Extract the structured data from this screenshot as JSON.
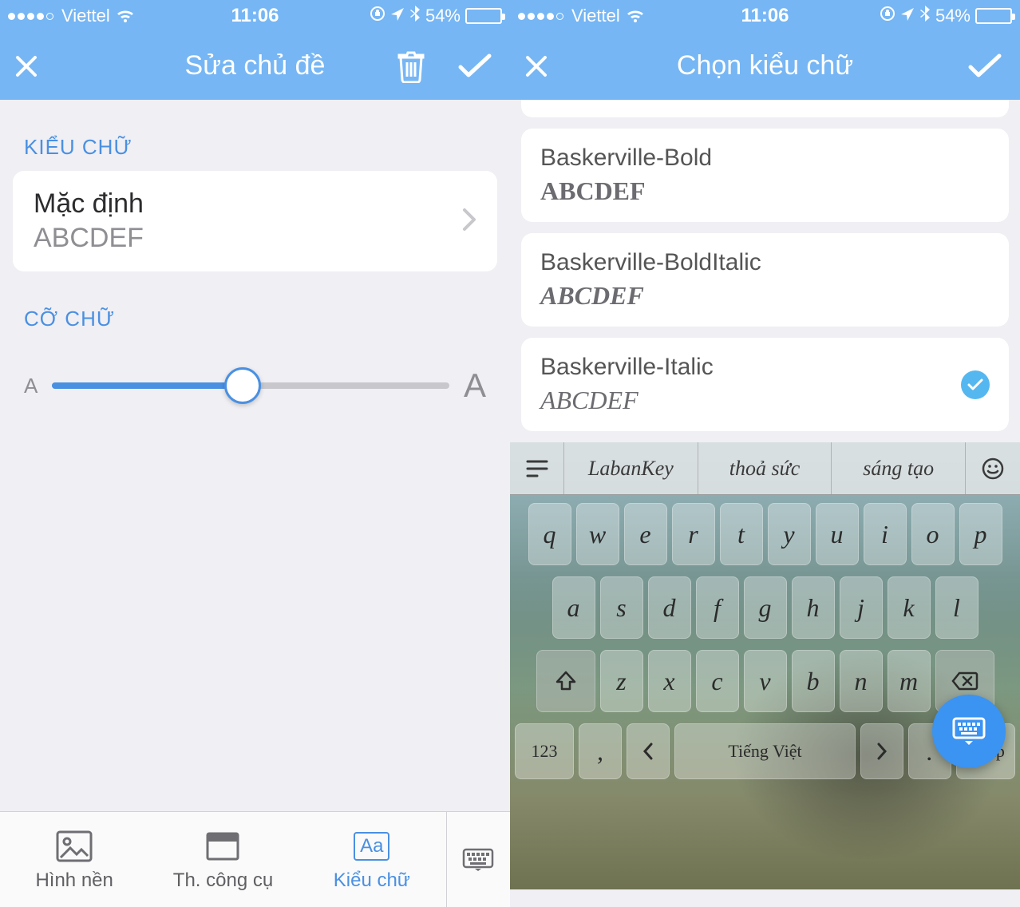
{
  "status": {
    "carrier": "Viettel",
    "time": "11:06",
    "battery_pct": "54%"
  },
  "left": {
    "nav_title": "Sửa chủ đề",
    "section_font": "KIỂU CHỮ",
    "font_row": {
      "title": "Mặc định",
      "sample": "ABCDEF"
    },
    "section_size": "CỠ CHỮ",
    "slider_min_label": "A",
    "slider_max_label": "A",
    "tabs": {
      "bg": "Hình nền",
      "toolbar": "Th. công cụ",
      "font": "Kiểu chữ",
      "aa": "Aa"
    }
  },
  "right": {
    "nav_title": "Chọn kiểu chữ",
    "fonts": [
      {
        "name": "Baskerville-Bold",
        "sample": "ABCDEF",
        "style": "fs-bold",
        "selected": false
      },
      {
        "name": "Baskerville-BoldItalic",
        "sample": "ABCDEF",
        "style": "fs-bolditalic",
        "selected": false
      },
      {
        "name": "Baskerville-Italic",
        "sample": "ABCDEF",
        "style": "fs-italic",
        "selected": true
      }
    ]
  },
  "keyboard": {
    "suggestions": [
      "LabanKey",
      "thoả sức",
      "sáng tạo"
    ],
    "row1": [
      "q",
      "w",
      "e",
      "r",
      "t",
      "y",
      "u",
      "i",
      "o",
      "p"
    ],
    "row2": [
      "a",
      "s",
      "d",
      "f",
      "g",
      "h",
      "j",
      "k",
      "l"
    ],
    "row3": [
      "z",
      "x",
      "c",
      "v",
      "b",
      "n",
      "m"
    ],
    "row4": {
      "num": "123",
      "comma": ",",
      "space": "Tiếng Việt",
      "period": ".",
      "return": "Nhập"
    }
  }
}
